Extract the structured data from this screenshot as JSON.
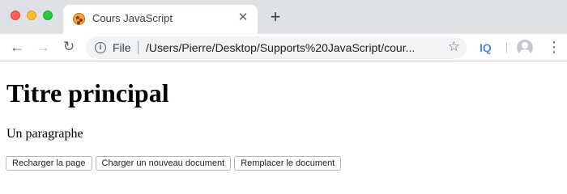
{
  "browser": {
    "tab": {
      "title": "Cours JavaScript",
      "close_glyph": "✕"
    },
    "new_tab_glyph": "+",
    "toolbar": {
      "back_glyph": "←",
      "forward_glyph": "→",
      "reload_glyph": "↻",
      "info_glyph": "i",
      "scheme_label": "File",
      "url": "/Users/Pierre/Desktop/Supports%20JavaScript/cour...",
      "star_glyph": "☆",
      "extension_label": "IQ",
      "menu_glyph": "⋮"
    }
  },
  "page": {
    "heading": "Titre principal",
    "paragraph": "Un paragraphe",
    "buttons": [
      "Recharger la page",
      "Charger un nouveau document",
      "Remplacer le document"
    ]
  }
}
